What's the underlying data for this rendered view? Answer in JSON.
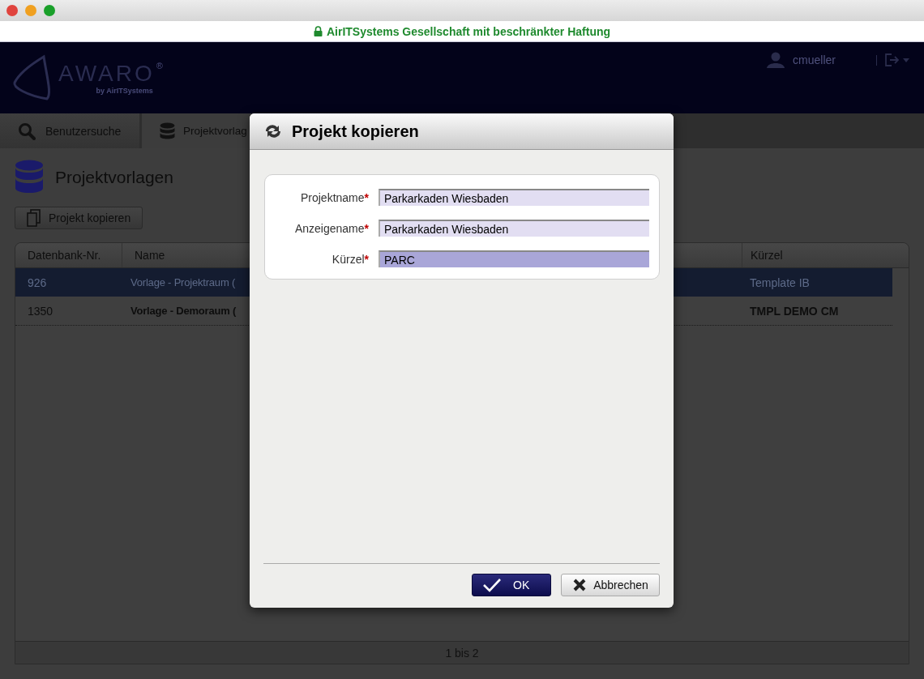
{
  "browser": {
    "site_identity": "AirITSystems Gesellschaft mit beschränkter Haftung"
  },
  "header": {
    "logo": "AWARO",
    "logo_mark": "®",
    "logo_byline": "by AirITSystems",
    "user": "cmueller"
  },
  "tabs": [
    {
      "label": "Benutzersuche",
      "selected": false
    },
    {
      "label": "Projektvorlag",
      "selected": true
    }
  ],
  "page": {
    "title": "Projektvorlagen",
    "copy_button": "Projekt kopieren"
  },
  "table": {
    "columns": [
      "Datenbank-Nr.",
      "Name",
      "Kürzel"
    ],
    "rows": [
      {
        "cells": [
          "926",
          "Vorlage - Projektraum (",
          "Template IB"
        ],
        "selected": true
      },
      {
        "cells": [
          "1350",
          "Vorlage - Demoraum (",
          "TMPL DEMO CM"
        ],
        "selected": false
      }
    ],
    "footer": "1 bis 2"
  },
  "dialog": {
    "title": "Projekt kopieren",
    "fields": [
      {
        "label": "Projektname",
        "required_mark": "*",
        "value": "Parkarkaden Wiesbaden",
        "focused": false
      },
      {
        "label": "Anzeigename",
        "required_mark": "*",
        "value": "Parkarkaden Wiesbaden",
        "focused": false
      },
      {
        "label": "Kürzel",
        "required_mark": "*",
        "value": "PARC",
        "focused": true
      }
    ],
    "ok_button": "OK",
    "cancel_button": "Abbrechen"
  }
}
